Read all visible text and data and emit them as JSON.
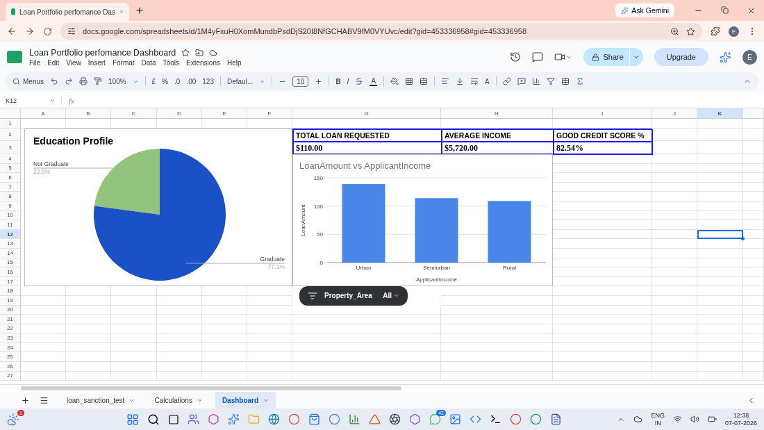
{
  "browser": {
    "tab_title": "Loan Portfolio perfomance Das",
    "ask_gemini": "Ask Gemini",
    "url": "docs.google.com/spreadsheets/d/1M4yFxuH0XomMundbPsdDjS20I8NfGCHABV9fM0VYUvc/edit?gid=453336958#gid=453336958",
    "profile_initial": "E"
  },
  "document": {
    "title": "Loan Portfolio perfomance Dashboard",
    "menus": [
      "File",
      "Edit",
      "View",
      "Insert",
      "Format",
      "Data",
      "Tools",
      "Extensions",
      "Help"
    ],
    "share": "Share",
    "upgrade": "Upgrade",
    "account_initial": "E"
  },
  "toolbar": {
    "search_label": "Menus",
    "zoom": "100%",
    "currency": "£",
    "percent": "%",
    "decrease_decimal": ".0",
    "increase_decimal": ".00",
    "number_format": "123",
    "font": "Defaul...",
    "font_size": "10",
    "bold": "B",
    "italic": "I",
    "text_color": "A",
    "text_style": "A"
  },
  "formula_bar": {
    "cell_reference": "K12",
    "formula_label": "fx"
  },
  "grid": {
    "columns": [
      {
        "label": "A",
        "selected": false
      },
      {
        "label": "B",
        "selected": false
      },
      {
        "label": "C",
        "selected": false
      },
      {
        "label": "D",
        "selected": false
      },
      {
        "label": "E",
        "selected": false
      },
      {
        "label": "F",
        "selected": false
      },
      {
        "label": "G",
        "selected": false
      },
      {
        "label": "H",
        "selected": false
      },
      {
        "label": "I",
        "selected": false
      },
      {
        "label": "J",
        "selected": false
      },
      {
        "label": "K",
        "selected": true
      }
    ],
    "rows": [
      {
        "label": "1",
        "selected": false
      },
      {
        "label": "2",
        "selected": false
      },
      {
        "label": "3",
        "selected": false
      },
      {
        "label": "4",
        "selected": false
      },
      {
        "label": "5",
        "selected": false
      },
      {
        "label": "6",
        "selected": false
      },
      {
        "label": "7",
        "selected": false
      },
      {
        "label": "8",
        "selected": false
      },
      {
        "label": "9",
        "selected": false
      },
      {
        "label": "10",
        "selected": false
      },
      {
        "label": "11",
        "selected": false
      },
      {
        "label": "12",
        "selected": true
      },
      {
        "label": "13",
        "selected": false
      },
      {
        "label": "14",
        "selected": false
      },
      {
        "label": "15",
        "selected": false
      },
      {
        "label": "16",
        "selected": false
      },
      {
        "label": "17",
        "selected": false
      },
      {
        "label": "18",
        "selected": false
      },
      {
        "label": "19",
        "selected": false
      },
      {
        "label": "20",
        "selected": false
      },
      {
        "label": "21",
        "selected": false
      },
      {
        "label": "22",
        "selected": false
      },
      {
        "label": "23",
        "selected": false
      },
      {
        "label": "24",
        "selected": false
      },
      {
        "label": "25",
        "selected": false
      },
      {
        "label": "26",
        "selected": false
      },
      {
        "label": "27",
        "selected": false
      }
    ]
  },
  "pie_chart": {
    "chart_data": {
      "type": "pie",
      "title": "Education Profile",
      "categories": [
        "Not Graduate",
        "Graduate"
      ],
      "values": [
        22.9,
        77.1
      ],
      "colors": [
        "#93c47d",
        "#1a51c7"
      ],
      "value_labels": [
        "22.9%",
        "77.1%"
      ]
    }
  },
  "kpi_table": {
    "headers": [
      "TOTAL LOAN REQUESTED",
      "AVERAGE INCOME",
      "GOOD CREDIT SCORE %"
    ],
    "values": [
      "$110.00",
      "$5,720.00",
      "82.54%"
    ]
  },
  "bar_chart": {
    "chart_data": {
      "type": "bar",
      "title": "LoanAmount vs ApplicantIncome",
      "xlabel": "ApplicantIncome",
      "ylabel": "LoanAmount",
      "categories": [
        "Urban",
        "Semiurban",
        "Rural"
      ],
      "series": [
        {
          "color": "#4a86e8",
          "values": [
            139,
            114,
            109
          ]
        }
      ],
      "ylim": [
        0,
        150
      ],
      "yticks": [
        0,
        50,
        100,
        150
      ]
    }
  },
  "filter_chip": {
    "column": "Property_Area",
    "value": "All"
  },
  "sheet_tabs": [
    {
      "label": "loan_sanction_test",
      "selected": false
    },
    {
      "label": "Calculations",
      "selected": false
    },
    {
      "label": "Dashboard",
      "selected": true
    }
  ],
  "taskbar": {
    "weather_badge": "1",
    "chat_badge": "42",
    "language": "ENG",
    "region": "IN",
    "time": "12:38",
    "date": "07-07-2026"
  }
}
